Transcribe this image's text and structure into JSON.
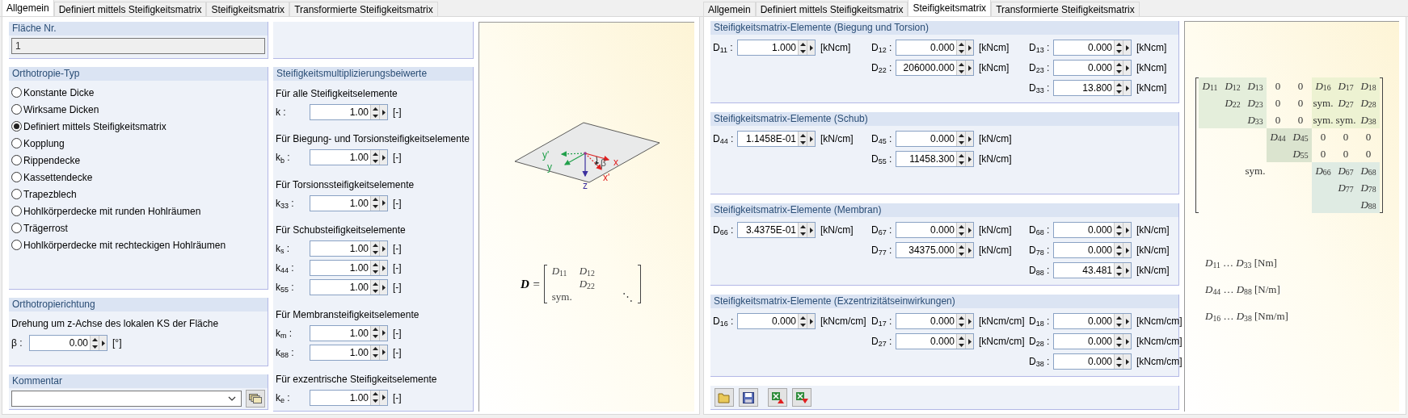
{
  "left_dialog": {
    "tabs": [
      {
        "label": "Allgemein",
        "selected": true
      },
      {
        "label": "Definiert mittels Steifigkeitsmatrix",
        "selected": false
      },
      {
        "label": "Steifigkeitsmatrix",
        "selected": false
      },
      {
        "label": "Transformierte Steifigkeitsmatrix",
        "selected": false
      }
    ],
    "surface_number": {
      "title": "Fläche Nr.",
      "value": "1",
      "disabled": true
    },
    "orthotropy_type": {
      "title": "Orthotropie-Typ",
      "options": [
        {
          "label": "Konstante Dicke",
          "selected": false
        },
        {
          "label": "Wirksame Dicken",
          "selected": false
        },
        {
          "label": "Definiert mittels Steifigkeitsmatrix",
          "selected": true
        },
        {
          "label": "Kopplung",
          "selected": false
        },
        {
          "label": "Rippendecke",
          "selected": false
        },
        {
          "label": "Kassettendecke",
          "selected": false
        },
        {
          "label": "Trapezblech",
          "selected": false
        },
        {
          "label": "Hohlkörperdecke mit runden Hohlräumen",
          "selected": false
        },
        {
          "label": "Trägerrost",
          "selected": false
        },
        {
          "label": "Hohlkörperdecke mit rechteckigen Hohlräumen",
          "selected": false
        }
      ]
    },
    "orthotropy_direction": {
      "title": "Orthotropierichtung",
      "description": "Drehung um z-Achse des lokalen KS der Fläche",
      "field": {
        "label": "β :",
        "value": "0.00",
        "unit": "[°]"
      }
    },
    "comment": {
      "title": "Kommentar"
    },
    "multipliers": {
      "title": "Steifigkeitsmultiplizierungsbeiwerte",
      "sections": [
        {
          "heading": "Für alle Steifigkeitselemente",
          "fields": [
            {
              "label": "k :",
              "value": "1.00",
              "unit": "[-]"
            }
          ]
        },
        {
          "heading": "Für Biegung- und Torsionsteifigkeitselemente",
          "fields": [
            {
              "label": "k$_{b}$ :",
              "value": "1.00",
              "unit": "[-]"
            }
          ]
        },
        {
          "heading": "Für Torsionssteifigkeitselemente",
          "fields": [
            {
              "label": "k$_{33}$ :",
              "value": "1.00",
              "unit": "[-]"
            }
          ]
        },
        {
          "heading": "Für Schubsteifigkeitselemente",
          "fields": [
            {
              "label": "k$_{s}$ :",
              "value": "1.00",
              "unit": "[-]"
            },
            {
              "label": "k$_{44}$ :",
              "value": "1.00",
              "unit": "[-]"
            },
            {
              "label": "k$_{55}$ :",
              "value": "1.00",
              "unit": "[-]"
            }
          ]
        },
        {
          "heading": "Für Membransteifigkeitselemente",
          "fields": [
            {
              "label": "k$_{m}$ :",
              "value": "1.00",
              "unit": "[-]"
            },
            {
              "label": "k$_{88}$ :",
              "value": "1.00",
              "unit": "[-]"
            }
          ]
        },
        {
          "heading": "Für exzentrische Steifigkeitselemente",
          "fields": [
            {
              "label": "k$_{e}$ :",
              "value": "1.00",
              "unit": "[-]"
            }
          ]
        }
      ]
    },
    "figure": {
      "axis_labels": [
        {
          "kind": "y_rotated",
          "text": "y'"
        },
        {
          "kind": "y",
          "text": "y"
        },
        {
          "kind": "z",
          "text": "z"
        },
        {
          "kind": "beta",
          "text": "β"
        },
        {
          "kind": "x",
          "text": "x"
        },
        {
          "kind": "x_rotated",
          "text": "x'"
        }
      ],
      "formula": {
        "lhs": "**D** =",
        "upper": [
          [
            "*D*$_{11}$",
            "*D*$_{12}$"
          ],
          [
            "*D*$_{22}$"
          ]
        ],
        "lower": "sym.",
        "diagonal": "⋱"
      }
    }
  },
  "right_dialog": {
    "tabs": [
      {
        "label": "Allgemein",
        "selected": false
      },
      {
        "label": "Definiert mittels Steifigkeitsmatrix",
        "selected": false
      },
      {
        "label": "Steifigkeitsmatrix",
        "selected": true
      },
      {
        "label": "Transformierte Steifigkeitsmatrix",
        "selected": false
      }
    ],
    "groups": [
      {
        "title": "Steifigkeitsmatrix-Elemente (Biegung und Torsion)",
        "columns": [
          [
            {
              "label": "D$_{11}$ :",
              "value": "1.000",
              "unit": "[kNcm]"
            }
          ],
          [
            {
              "label": "D$_{12}$ :",
              "value": "0.000",
              "unit": "[kNcm]"
            },
            {
              "label": "D$_{22}$ :",
              "value": "206000.000",
              "unit": "[kNcm]"
            }
          ],
          [
            {
              "label": "D$_{13}$ :",
              "value": "0.000",
              "unit": "[kNcm]"
            },
            {
              "label": "D$_{23}$ :",
              "value": "0.000",
              "unit": "[kNcm]"
            },
            {
              "label": "D$_{33}$ :",
              "value": "13.800",
              "unit": "[kNcm]"
            }
          ]
        ]
      },
      {
        "title": "Steifigkeitsmatrix-Elemente (Schub)",
        "columns": [
          [
            {
              "label": "D$_{44}$ :",
              "value": "1.1458E-01",
              "unit": "[kN/cm]"
            }
          ],
          [
            {
              "label": "D$_{45}$ :",
              "value": "0.000",
              "unit": "[kN/cm]"
            },
            {
              "label": "D$_{55}$ :",
              "value": "11458.300",
              "unit": "[kN/cm]"
            }
          ]
        ]
      },
      {
        "title": "Steifigkeitsmatrix-Elemente (Membran)",
        "columns": [
          [
            {
              "label": "D$_{66}$ :",
              "value": "3.4375E-01",
              "unit": "[kN/cm]"
            }
          ],
          [
            {
              "label": "D$_{67}$ :",
              "value": "0.000",
              "unit": "[kN/cm]"
            },
            {
              "label": "D$_{77}$ :",
              "value": "34375.000",
              "unit": "[kN/cm]"
            }
          ],
          [
            {
              "label": "D$_{68}$ :",
              "value": "0.000",
              "unit": "[kN/cm]"
            },
            {
              "label": "D$_{78}$ :",
              "value": "0.000",
              "unit": "[kN/cm]"
            },
            {
              "label": "D$_{88}$ :",
              "value": "43.481",
              "unit": "[kN/cm]"
            }
          ]
        ]
      },
      {
        "title": "Steifigkeitsmatrix-Elemente (Exzentrizitätseinwirkungen)",
        "columns": [
          [
            {
              "label": "D$_{16}$ :",
              "value": "0.000",
              "unit": "[kNcm/cm]"
            }
          ],
          [
            {
              "label": "D$_{17}$ :",
              "value": "0.000",
              "unit": "[kNcm/cm]"
            },
            {
              "label": "D$_{27}$ :",
              "value": "0.000",
              "unit": "[kNcm/cm]"
            }
          ],
          [
            {
              "label": "D$_{18}$ :",
              "value": "0.000",
              "unit": "[kNcm/cm]"
            },
            {
              "label": "D$_{28}$ :",
              "value": "0.000",
              "unit": "[kNcm/cm]"
            },
            {
              "label": "D$_{38}$ :",
              "value": "0.000",
              "unit": "[kNcm/cm]"
            }
          ]
        ]
      }
    ],
    "figure": {
      "matrix_blocks": [
        {
          "kind": "bending",
          "color": "#e4eedb",
          "rows": [
            [
              "*D*$_{11}$",
              "*D*$_{12}$",
              "*D*$_{13}$"
            ],
            [
              "",
              "*D*$_{22}$",
              "*D*$_{23}$"
            ],
            [
              "",
              "",
              "*D*$_{33}$"
            ]
          ]
        },
        {
          "kind": "zeros_top",
          "rows": [
            [
              "0",
              "0"
            ],
            [
              "0",
              "0"
            ],
            [
              "0",
              "0"
            ]
          ]
        },
        {
          "kind": "eccentric",
          "color": "#edf2d2",
          "rows": [
            [
              "*D*$_{16}$",
              "*D*$_{17}$",
              "*D*$_{18}$"
            ],
            [
              "sym.",
              "*D*$_{27}$",
              "*D*$_{28}$"
            ],
            [
              "sym.",
              "sym.",
              "*D*$_{38}$"
            ]
          ]
        },
        {
          "kind": "shear",
          "color": "#dbe4cf",
          "rows": [
            [
              "*D*$_{44}$",
              "*D*$_{45}$"
            ],
            [
              "",
              "*D*$_{55}$"
            ]
          ]
        },
        {
          "kind": "zeros_right",
          "rows": [
            [
              "0",
              "0",
              "0"
            ],
            [
              "0",
              "0",
              "0"
            ]
          ]
        },
        {
          "kind": "sym",
          "rows": [
            [
              "sym."
            ]
          ]
        },
        {
          "kind": "membrane",
          "color": "#dfebe3",
          "rows": [
            [
              "*D*$_{66}$",
              "*D*$_{67}$",
              "*D*$_{68}$"
            ],
            [
              "",
              "*D*$_{77}$",
              "*D*$_{78}$"
            ],
            [
              "",
              "",
              "*D*$_{88}$"
            ]
          ]
        }
      ],
      "units": [
        "*D*$_{11}$ … *D*$_{33}$ [Nm]",
        "*D*$_{44}$ … *D*$_{88}$ [N/m]",
        "*D*$_{16}$ … *D*$_{38}$ [Nm/m]"
      ]
    }
  }
}
